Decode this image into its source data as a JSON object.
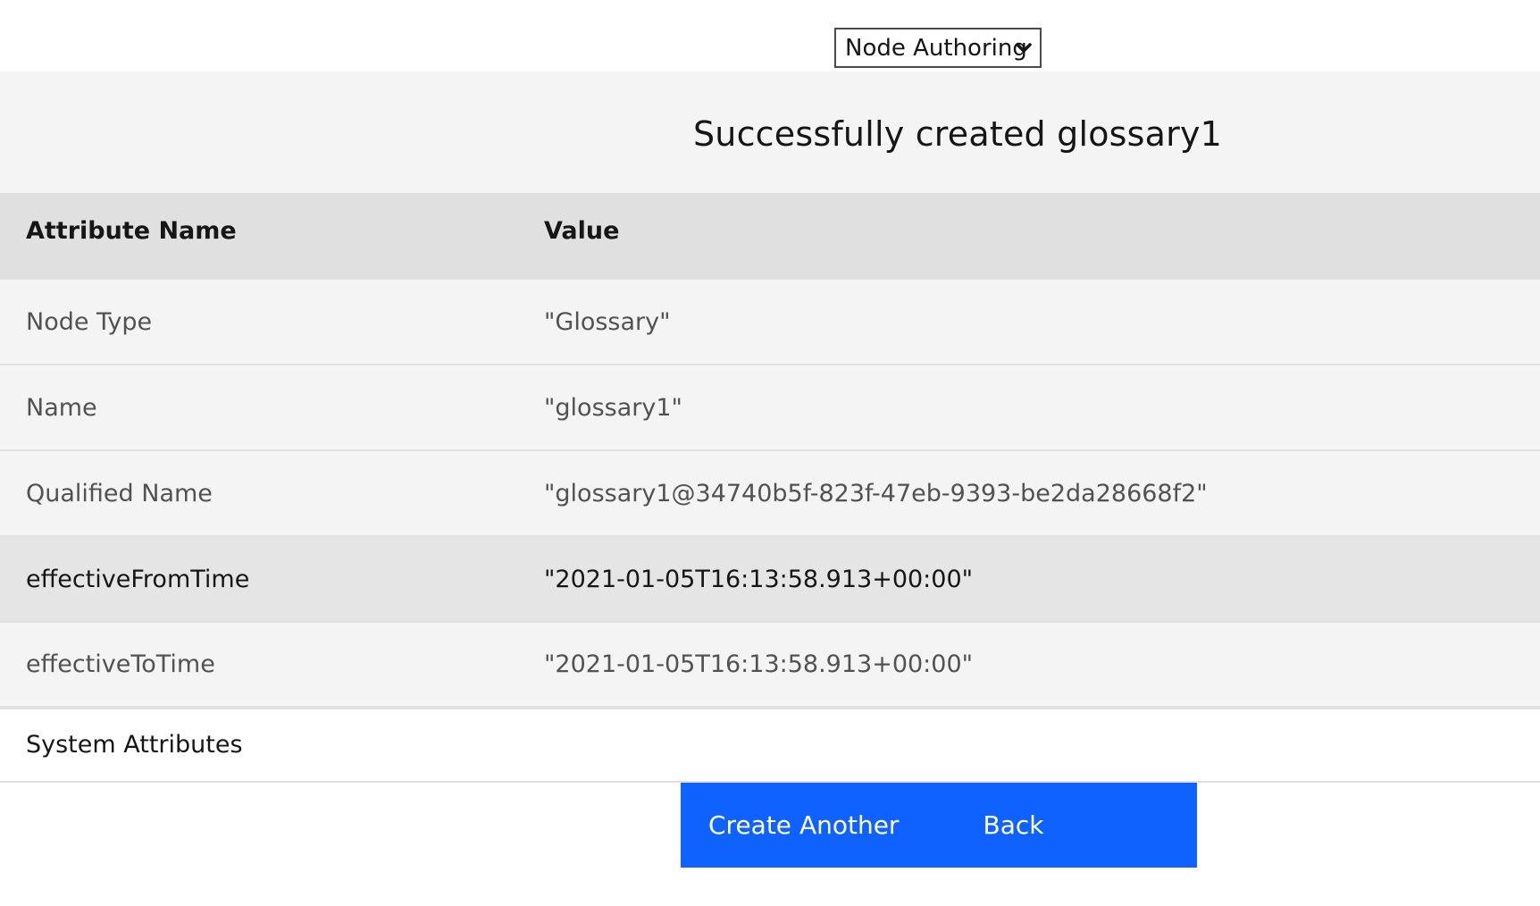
{
  "mode_select": {
    "value": "Node Authoring"
  },
  "notice": {
    "text": "Successfully created glossary1"
  },
  "table": {
    "headers": [
      "Attribute Name",
      "Value"
    ],
    "rows": [
      {
        "name": "Node Type",
        "value": "\"Glossary\""
      },
      {
        "name": "Name",
        "value": "\"glossary1\""
      },
      {
        "name": "Qualified Name",
        "value": "\"glossary1@34740b5f-823f-47eb-9393-be2da28668f2\""
      },
      {
        "name": "effectiveFromTime",
        "value": "\"2021-01-05T16:13:58.913+00:00\""
      },
      {
        "name": "effectiveToTime",
        "value": "\"2021-01-05T16:13:58.913+00:00\""
      }
    ]
  },
  "system_attributes": {
    "label": "System Attributes"
  },
  "actions": {
    "create_another": "Create Another",
    "back": "Back"
  },
  "colors": {
    "primary": "#0f62fe",
    "panel": "#f4f4f4",
    "header": "#e0e0e0"
  }
}
